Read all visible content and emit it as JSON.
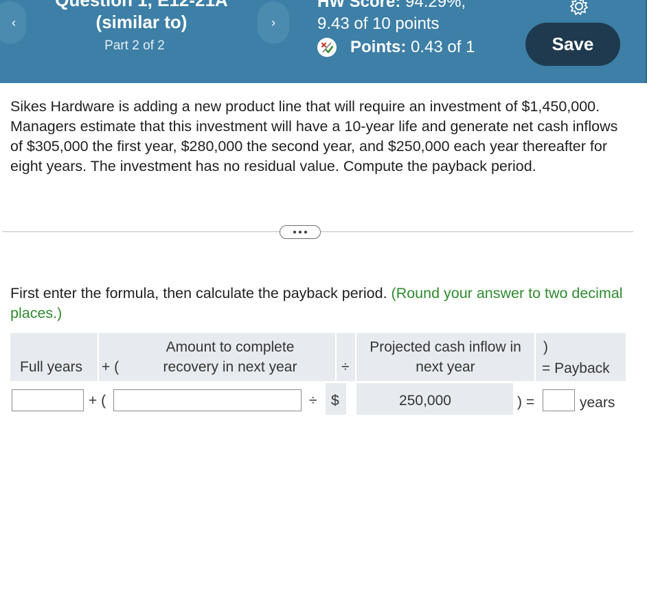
{
  "header": {
    "question_title_line1": "Question 1, E12-21A",
    "question_title_line2": "(similar to)",
    "part": "Part 2 of 2",
    "hw_score_label": "HW Score:",
    "hw_score_value": "94.29%,",
    "points_total": "9.43 of 10 points",
    "points_label": "Points:",
    "points_value": "0.43 of 1",
    "prev_icon": "chevron-left-icon",
    "next_icon": "chevron-right-icon",
    "settings_icon": "gear-icon",
    "save_label": "Save",
    "accent": "#3d7fa6",
    "save_bg": "#1f3a4f"
  },
  "question": {
    "text": "Sikes Hardware is adding a new product line that will require an investment of $1,450,000. Managers estimate that this investment will have a 10-year life and generate net cash inflows of $305,000 the first year, $280,000 the second year, and $250,000 each year thereafter for eight years. The investment has no residual value. Compute the payback period."
  },
  "instructions": {
    "main": "First enter the formula, then calculate the payback period.",
    "hint": "(Round your answer to two decimal places.)",
    "hint_color": "#2e8b2e"
  },
  "formula": {
    "col_full_years": "Full years",
    "plus_paren": "+ (",
    "col_amount_line1": "Amount to complete",
    "col_amount_line2": "recovery in next year",
    "divide": "÷",
    "col_cash_line1": "Projected cash inflow in",
    "col_cash_line2": "next year",
    "close_paren": ")",
    "equals_payback": "= Payback",
    "row": {
      "full_years_value": "",
      "plus_paren": "+ (",
      "amount_value": "",
      "divide": "÷",
      "dollar": "$",
      "cash_value": "250,000",
      "close_equals": ") =",
      "payback_value": "",
      "unit": "years"
    }
  }
}
